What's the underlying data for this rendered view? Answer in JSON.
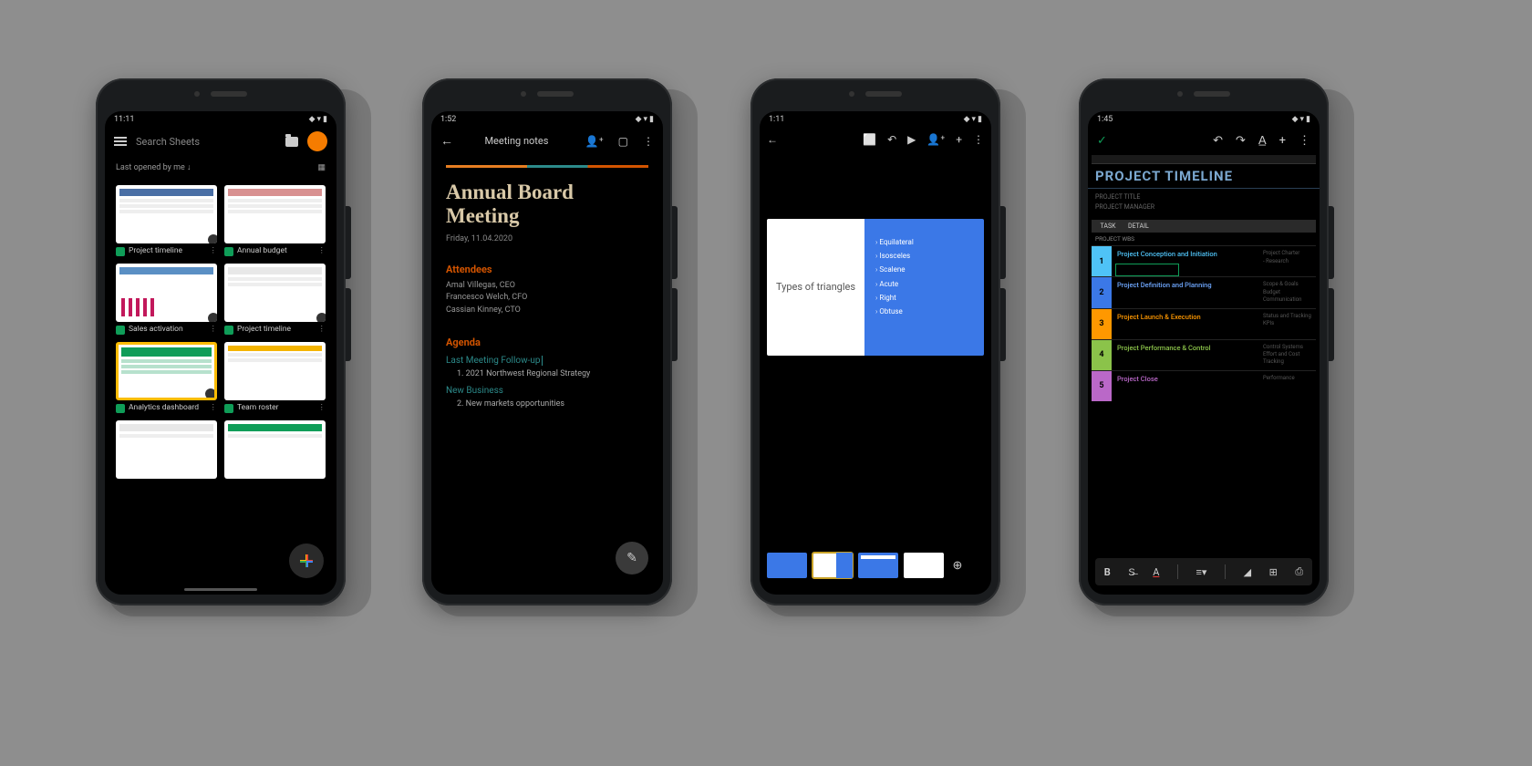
{
  "phone1": {
    "time": "11:11",
    "search_placeholder": "Search Sheets",
    "filter_label": "Last opened by me",
    "files": [
      {
        "name": "Project timeline"
      },
      {
        "name": "Annual budget"
      },
      {
        "name": "Sales activation"
      },
      {
        "name": "Project timeline"
      },
      {
        "name": "Analytics dashboard"
      },
      {
        "name": "Team roster"
      }
    ]
  },
  "phone2": {
    "time": "1:52",
    "doc_title": "Meeting notes",
    "h1": "Annual Board Meeting",
    "date": "Friday, 11.04.2020",
    "attendees_heading": "Attendees",
    "attendees": "Amal Villegas, CEO\nFrancesco Welch, CFO\nCassian Kinney, CTO",
    "agenda_heading": "Agenda",
    "sub1": "Last Meeting Follow-up",
    "item1": "1.   2021 Northwest Regional Strategy",
    "sub2": "New Business",
    "item2": "2.   New markets opportunities"
  },
  "phone3": {
    "time": "1:11",
    "slide_title": "Types of triangles",
    "bullets": [
      "Equilateral",
      "Isosceles",
      "Scalene",
      "Acute",
      "Right",
      "Obtuse"
    ]
  },
  "phone4": {
    "time": "1:45",
    "title": "PROJECT TIMELINE",
    "meta1": "PROJECT TITLE",
    "meta2": "PROJECT MANAGER",
    "col1": "TASK",
    "col2": "DETAIL",
    "wbs_label": "PROJECT WBS",
    "rows": [
      {
        "n": "1",
        "color": "#4fc3f7",
        "tc": "#4fc3f7",
        "t": "Project Conception and Initiation",
        "s": "Project Charter\n- Research"
      },
      {
        "n": "2",
        "color": "#3b78e7",
        "tc": "#6fa8ff",
        "t": "Project Definition and Planning",
        "s": "Scope & Goals\nBudget\nCommunication"
      },
      {
        "n": "3",
        "color": "#ff9800",
        "tc": "#ff9800",
        "t": "Project Launch & Execution",
        "s": "Status and Tracking\nKPIs"
      },
      {
        "n": "4",
        "color": "#8bc34a",
        "tc": "#8bc34a",
        "t": "Project Performance & Control",
        "s": "Control Systems\nEffort and Cost Tracking"
      },
      {
        "n": "5",
        "color": "#ba68c8",
        "tc": "#ba68c8",
        "t": "Project Close",
        "s": "Performance"
      }
    ]
  }
}
